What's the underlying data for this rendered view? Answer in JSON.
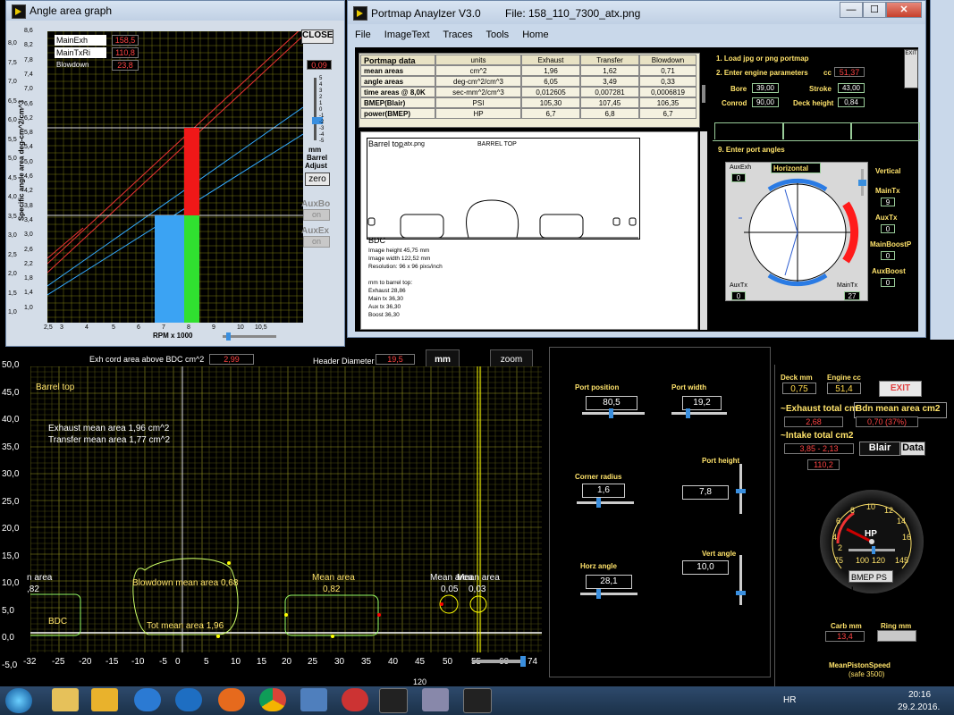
{
  "angle_window": {
    "title": "Angle area graph",
    "close_label": "CLOSE",
    "zero_label": "zero",
    "legend": [
      {
        "label": "MainExh",
        "value": "158,5"
      },
      {
        "label": "MainTxRi",
        "value": "110,8"
      },
      {
        "label": "Blowdown",
        "value": "23,8"
      }
    ],
    "barrel_value": "0,09",
    "barrel_text": {
      "a": "mm",
      "b": "Barrel",
      "c": "Adjust"
    },
    "aux_bo": "AuxBo",
    "aux_ex": "AuxEx",
    "on1": "on",
    "on2": "on",
    "slider_ticks": [
      "5",
      "4",
      "3",
      "2",
      "1",
      "0",
      "-1",
      "-2",
      "-3",
      "-4",
      "-5"
    ],
    "ylabel": "Specific angle area  deg-cm^2/cm^3",
    "xlabel": "RPM x 1000",
    "yticks": [
      "8,6",
      "8,2",
      "7,8",
      "7,4",
      "7,0",
      "6,6",
      "6,2",
      "5,8",
      "5,4",
      "5,0",
      "4,6",
      "4,2",
      "3,8",
      "3,4",
      "3,0",
      "2,6",
      "2,2",
      "1,8",
      "1,4",
      "1,0"
    ],
    "yticks2": [
      "8,0",
      "7,5",
      "7,0",
      "6,5",
      "6,0",
      "5,5",
      "5,0",
      "4,5",
      "4,0",
      "3,5",
      "3,0",
      "2,5",
      "2,0",
      "1,5",
      "1,0"
    ],
    "xticks": [
      "2,5",
      "3",
      "4",
      "5",
      "6",
      "7",
      "8",
      "9",
      "10",
      "10,5"
    ]
  },
  "portmap_window": {
    "title": "Portmap Anaylzer V3.0",
    "file": "File: 158_110_7300_atx.png",
    "menu": [
      "File",
      "ImageText",
      "Traces",
      "Tools",
      "Home"
    ],
    "table": {
      "header": [
        "Portmap data",
        "units",
        "Exhaust",
        "Transfer",
        "Blowdown"
      ],
      "rows": [
        [
          "mean areas",
          "cm^2",
          "1,96",
          "1,62",
          "0,71"
        ],
        [
          "angle areas",
          "deg-cm^2/cm^3",
          "6,05",
          "3,49",
          "0,33"
        ],
        [
          "time areas @ 8,0K",
          "sec-mm^2/cm^3",
          "0,012605",
          "0,007281",
          "0,0006819"
        ],
        [
          "BMEP(Blair)",
          "PSI",
          "105,30",
          "107,45",
          "106,35"
        ],
        [
          "power(BMEP)",
          "HP",
          "6,7",
          "6,8",
          "6,7"
        ]
      ]
    },
    "steps": {
      "s1": "1. Load jpg or png portmap",
      "s2": "2. Enter engine parameters",
      "s9": "9. Enter port angles"
    },
    "params": {
      "cc_label": "cc",
      "cc": "51,37",
      "bore_label": "Bore",
      "bore": "39,00",
      "stroke_label": "Stroke",
      "stroke": "43,00",
      "conrod_label": "Conrod",
      "conrod": "90,00",
      "deck_label": "Deck height",
      "deck": "0,84"
    },
    "exit": "EXIT",
    "image": {
      "title": "Barrel top",
      "file": "_atx.png",
      "barrel_top": "BARREL TOP",
      "bdc": "BDC",
      "info": [
        "Image height  45,75 mm",
        "Image width  122,52 mm",
        "Resolution: 96 x 96 pixs/inch",
        "",
        "mm to barrel top:",
        "Exhaust  28,86",
        "Main tx   36,30",
        "Aux tx    36,30",
        "Boost     36,30"
      ]
    },
    "angles": {
      "auxexh": "AuxExh",
      "auxexh_v": "0",
      "horizontal": "Horizontal",
      "vertical": "Vertical",
      "maintx": "MainTx",
      "maintx_v": "9",
      "auxtx": "AuxTx",
      "auxtx_v": "0",
      "mainboost": "MainBoostP",
      "mainboost_v": "0",
      "auxboost": "AuxBoost",
      "auxboost_v": "0",
      "auxtx_b": "AuxTx",
      "auxtx_b_v": "0",
      "maintx_b": "MainTx",
      "maintx_b_v": "27"
    }
  },
  "main_panel": {
    "exh_cord_label": "Exh cord area above BDC  cm^2",
    "exh_cord_value": "2,99",
    "header_label": "Header Diameter",
    "header_value": "19,5",
    "mm_label": "mm",
    "zoom_label": "zoom",
    "barrel_top": "Barrel top",
    "exh_mean": "Exhaust mean area  1,96 cm^2",
    "tr_mean": "Transfer mean area 1,77 cm^2",
    "blowdown": "Blowdown mean area 0,68",
    "tot_mean": "Tot mean area 1,96",
    "mean_area_1": "Mean area",
    "mean_val_1": "0,82",
    "mean_area_2": "Mean area",
    "mean_val_2": "0,05",
    "mean_area_3": "Mean area",
    "mean_val_3": "0,03",
    "left_mean": "n area",
    "left_val": ",82",
    "bdc": "BDC",
    "yticks": [
      "50,0",
      "45,0",
      "40,0",
      "35,0",
      "30,0",
      "25,0",
      "20,0",
      "15,0",
      "10,0",
      "5,0",
      "0,0",
      "-5,0"
    ],
    "xticks": [
      "-32",
      "-25",
      "-20",
      "-15",
      "-10",
      "-5",
      "0",
      "5",
      "10",
      "15",
      "20",
      "25",
      "30",
      "35",
      "40",
      "45",
      "50",
      "55",
      "60",
      "74"
    ],
    "ylabel": "mm",
    "xlabel": "mm",
    "small_tick": "120"
  },
  "controls": {
    "port_position": "Port position",
    "port_position_v": "80,5",
    "port_width": "Port width",
    "port_width_v": "19,2",
    "corner_radius": "Corner radius",
    "corner_radius_v": "1,6",
    "port_height": "Port height",
    "port_height_v": "7,8",
    "horz_angle": "Horz angle",
    "horz_angle_v": "28,1",
    "vert_angle": "Vert angle",
    "vert_angle_v": "10,0"
  },
  "right_panel": {
    "deck_mm": "Deck mm",
    "deck_mm_v": "0,75",
    "engine_cc": "Engine cc",
    "engine_cc_v": "51,4",
    "exit": "EXIT",
    "exhaust_total": "~Exhaust total cm",
    "exhaust_total_v": "2,68",
    "bdn_mean": "Bdn mean area cm2",
    "bdn_mean_v": "0,70  (37%)",
    "intake_total": "~Intake total cm2",
    "intake_total_v": "3,85 - 2,13",
    "blair": "Blair",
    "data": "Data",
    "value_110": "110,2",
    "gauge_ticks": [
      "2",
      "4",
      "6",
      "8",
      "10",
      "12",
      "14",
      "16"
    ],
    "gauge_bottom": [
      "75",
      "100",
      "120",
      "145"
    ],
    "gauge_unit": "HP",
    "bmep": "BMEP PS",
    "bmep_l": "L",
    "carb": "Carb mm",
    "carb_v": "13,4",
    "ring": "Ring mm",
    "mps": "MeanPistonSpeed",
    "safe": "(safe 3500)"
  },
  "taskbar": {
    "lang": "HR",
    "time": "20:16",
    "date": "29.2.2016."
  }
}
